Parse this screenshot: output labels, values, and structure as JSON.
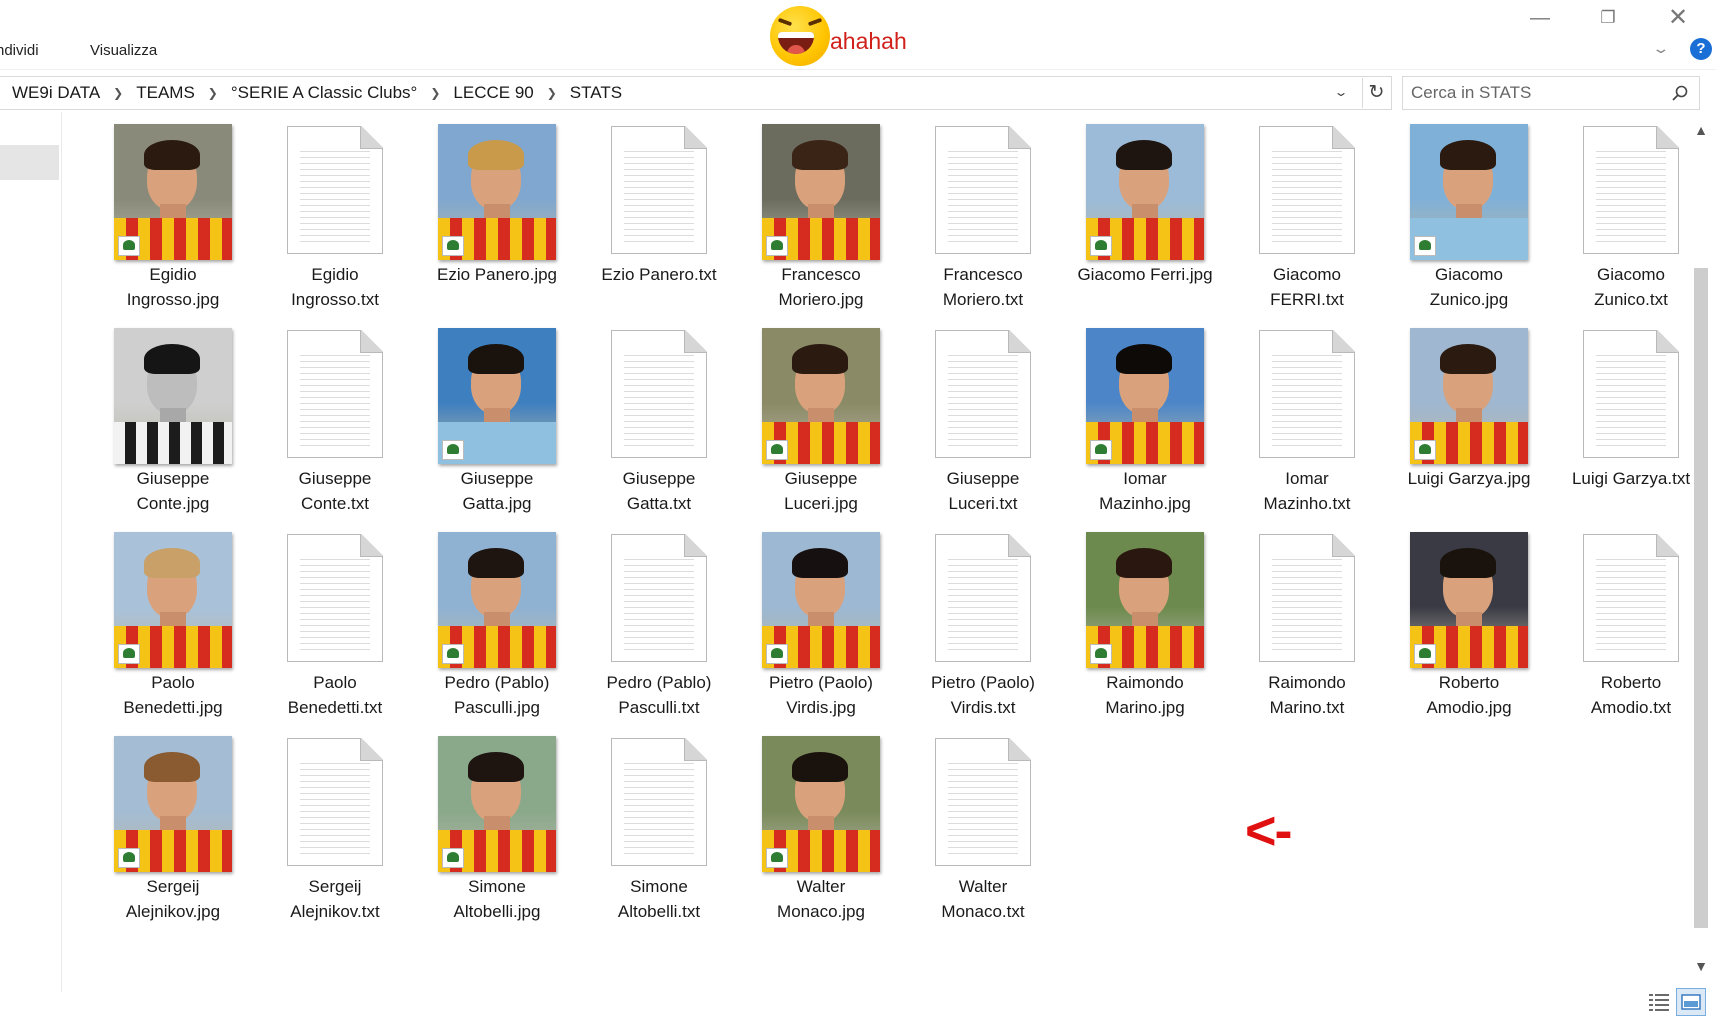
{
  "ribbon": {
    "tabs": [
      "ndividi",
      "Visualizza"
    ],
    "title_text": "ahahah"
  },
  "window_controls": {
    "minimize": "—",
    "maximize": "❐",
    "close": "✕",
    "help": "?"
  },
  "breadcrumb": [
    "WE9i DATA",
    "TEAMS",
    "°SERIE A Classic Clubs°",
    "LECCE 90",
    "STATS"
  ],
  "search": {
    "placeholder": "Cerca in STATS"
  },
  "annotation": "<-",
  "colors": {
    "accent": "#1a6fd6",
    "annotation": "#e01010",
    "lecce_red": "#d62b1f",
    "lecce_yellow": "#f4c316"
  },
  "files": [
    {
      "label": "Egidio\nIngrosso.jpg",
      "type": "image",
      "kit": "lecce",
      "sky": "#8a8a7a",
      "hair": "#2a1a10"
    },
    {
      "label": "Egidio\nIngrosso.txt",
      "type": "text"
    },
    {
      "label": "Ezio Panero.jpg",
      "type": "image",
      "kit": "lecce",
      "sky": "#7fa7cf",
      "hair": "#c89a4a"
    },
    {
      "label": "Ezio Panero.txt",
      "type": "text"
    },
    {
      "label": "Francesco\nMoriero.jpg",
      "type": "image",
      "kit": "lecce",
      "sky": "#6b6b5e",
      "hair": "#3a2416"
    },
    {
      "label": "Francesco\nMoriero.txt",
      "type": "text"
    },
    {
      "label": "Giacomo Ferri.jpg",
      "type": "image",
      "kit": "lecce",
      "sky": "#9bbbd8",
      "hair": "#1e1410"
    },
    {
      "label": "Giacomo\nFERRI.txt",
      "type": "text"
    },
    {
      "label": "Giacomo\nZunico.jpg",
      "type": "image",
      "kit": "keeper",
      "sky": "#7fb0d8",
      "hair": "#2a1a10"
    },
    {
      "label": "Giacomo\nZunico.txt",
      "type": "text"
    },
    {
      "label": "Giuseppe\nConte.jpg",
      "type": "image",
      "kit": "bw",
      "sky": "#cfcfcf",
      "hair": "#151515"
    },
    {
      "label": "Giuseppe\nConte.txt",
      "type": "text"
    },
    {
      "label": "Giuseppe\nGatta.jpg",
      "type": "image",
      "kit": "keeper",
      "sky": "#3e7fc0",
      "hair": "#1a120c"
    },
    {
      "label": "Giuseppe\nGatta.txt",
      "type": "text"
    },
    {
      "label": "Giuseppe\nLuceri.jpg",
      "type": "image",
      "kit": "lecce",
      "sky": "#8a8a66",
      "hair": "#2a1a10"
    },
    {
      "label": "Giuseppe\nLuceri.txt",
      "type": "text"
    },
    {
      "label": "Iomar\nMazinho.jpg",
      "type": "image",
      "kit": "lecce",
      "sky": "#4c86c8",
      "hair": "#0e0a08"
    },
    {
      "label": "Iomar\nMazinho.txt",
      "type": "text"
    },
    {
      "label": "Luigi Garzya.jpg",
      "type": "image",
      "kit": "lecce",
      "sky": "#9fb7d0",
      "hair": "#2a1a10"
    },
    {
      "label": "Luigi Garzya.txt",
      "type": "text"
    },
    {
      "label": "Paolo\nBenedetti.jpg",
      "type": "image",
      "kit": "lecce",
      "sky": "#a9c2da",
      "hair": "#c8a068"
    },
    {
      "label": "Paolo\nBenedetti.txt",
      "type": "text"
    },
    {
      "label": "Pedro (Pablo)\nPasculli.jpg",
      "type": "image",
      "kit": "lecce",
      "sky": "#8fb2d3",
      "hair": "#1e1410"
    },
    {
      "label": "Pedro (Pablo)\nPasculli.txt",
      "type": "text"
    },
    {
      "label": "Pietro (Paolo)\nVirdis.jpg",
      "type": "image",
      "kit": "lecce",
      "sky": "#9cb8d2",
      "hair": "#161010"
    },
    {
      "label": "Pietro (Paolo)\nVirdis.txt",
      "type": "text"
    },
    {
      "label": "Raimondo\nMarino.jpg",
      "type": "image",
      "kit": "lecce",
      "sky": "#6d8a4e",
      "hair": "#2a1810"
    },
    {
      "label": "Raimondo\nMarino.txt",
      "type": "text"
    },
    {
      "label": "Roberto\nAmodio.jpg",
      "type": "image",
      "kit": "lecce",
      "sky": "#3a3a44",
      "hair": "#1a120c"
    },
    {
      "label": "Roberto\nAmodio.txt",
      "type": "text"
    },
    {
      "label": "Sergeij\nAlejnikov.jpg",
      "type": "image",
      "kit": "lecce",
      "sky": "#a4bcd4",
      "hair": "#8a5a30"
    },
    {
      "label": "Sergeij\nAlejnikov.txt",
      "type": "text"
    },
    {
      "label": "Simone\nAltobelli.jpg",
      "type": "image",
      "kit": "lecce",
      "sky": "#8aa88a",
      "hair": "#1e1410"
    },
    {
      "label": "Simone\nAltobelli.txt",
      "type": "text"
    },
    {
      "label": "Walter\nMonaco.jpg",
      "type": "image",
      "kit": "lecce",
      "sky": "#7a8a5a",
      "hair": "#1a120c"
    },
    {
      "label": "Walter\nMonaco.txt",
      "type": "text"
    }
  ]
}
